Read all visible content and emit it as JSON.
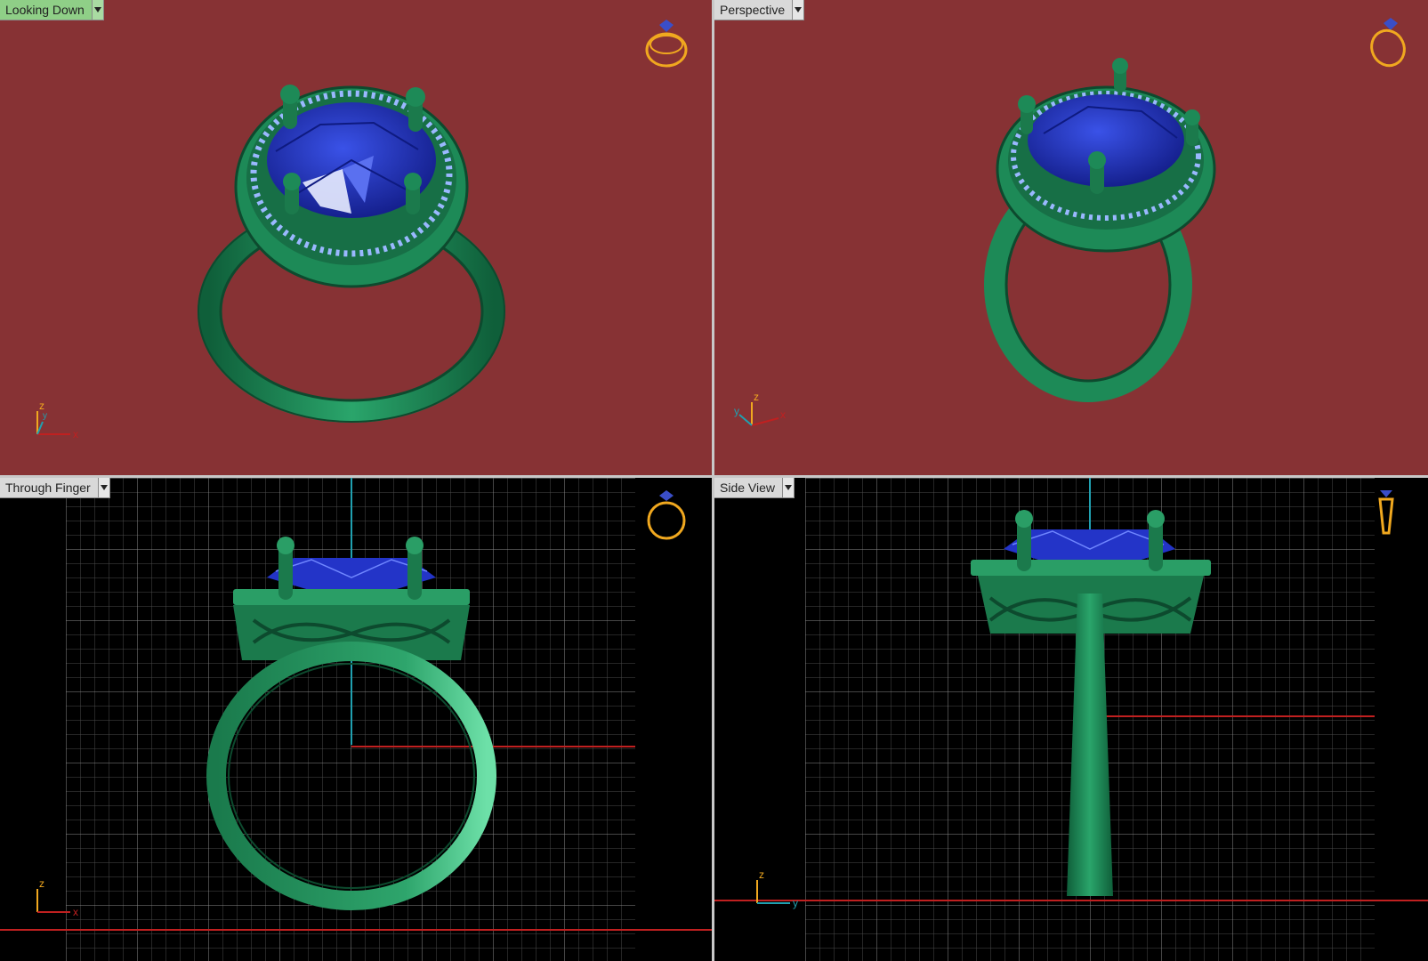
{
  "colors": {
    "background_shaded": "#873234",
    "background_wire": "#000000",
    "metal": "#1f8a58",
    "metal_light": "#43c488",
    "gem": "#2334c8",
    "gem_light": "#7f94ff",
    "accent_melee": "#8ab0ff",
    "icon_gold": "#f0a81f",
    "grid": "#5c5c5c",
    "axis_red": "#c02020",
    "axis_cyan": "#20a0b0"
  },
  "viewports": [
    {
      "id": "top-left",
      "label": "Looking Down",
      "active": true,
      "mode": "shaded",
      "axes": {
        "v": "z",
        "h": "x",
        "d": "y"
      },
      "icon": "ring-icon"
    },
    {
      "id": "top-right",
      "label": "Perspective",
      "active": false,
      "mode": "shaded",
      "axes": {
        "v": "z",
        "h": "x",
        "d": "y"
      },
      "icon": "ring-icon"
    },
    {
      "id": "bottom-left",
      "label": "Through Finger",
      "active": false,
      "mode": "wire",
      "axes": {
        "v": "z",
        "h": "x",
        "d": ""
      },
      "icon": "ring-front-icon"
    },
    {
      "id": "bottom-right",
      "label": "Side View",
      "active": false,
      "mode": "wire",
      "axes": {
        "v": "z",
        "h": "y",
        "d": ""
      },
      "icon": "ring-side-icon"
    }
  ]
}
